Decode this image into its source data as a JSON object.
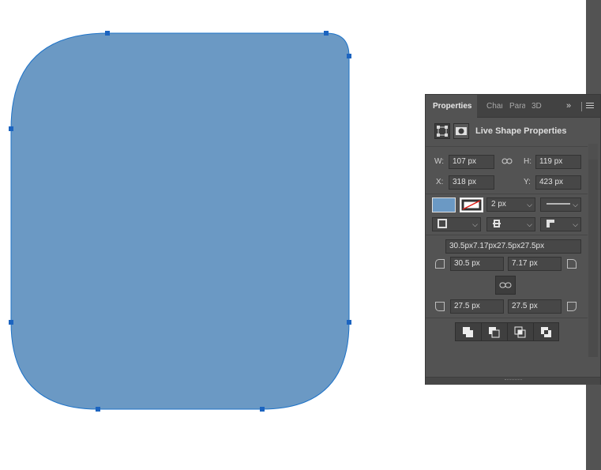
{
  "canvas": {
    "shape_fill": "#6b99c4",
    "path_stroke": "#1e73c8",
    "anchor_color": "#1c64c0",
    "background": "#ffffff"
  },
  "panel": {
    "tabs": [
      {
        "label": "Properties",
        "active": true
      },
      {
        "label": "Char",
        "active": false
      },
      {
        "label": "Para",
        "active": false
      },
      {
        "label": "3D",
        "active": false
      }
    ],
    "expand_icon": "»",
    "menu_icon": "panel-menu-icon",
    "title": "Live Shape Properties",
    "transform": {
      "w_label": "W:",
      "w_value": "107 px",
      "h_label": "H:",
      "h_value": "119 px",
      "x_label": "X:",
      "x_value": "318 px",
      "y_label": "Y:",
      "y_value": "423 px"
    },
    "appearance": {
      "fill_color": "#6b99c4",
      "stroke_color": "#ffffff",
      "stroke_width": "2 px",
      "stroke_style": "solid"
    },
    "corners": {
      "combined": "30.5px7.17px27.5px27.5px",
      "top_left": "30.5 px",
      "top_right": "7.17 px",
      "bottom_left": "27.5 px",
      "bottom_right": "27.5 px"
    },
    "path_operations": [
      "combine-shapes-icon",
      "subtract-front-icon",
      "intersect-shapes-icon",
      "exclude-overlap-icon"
    ]
  }
}
